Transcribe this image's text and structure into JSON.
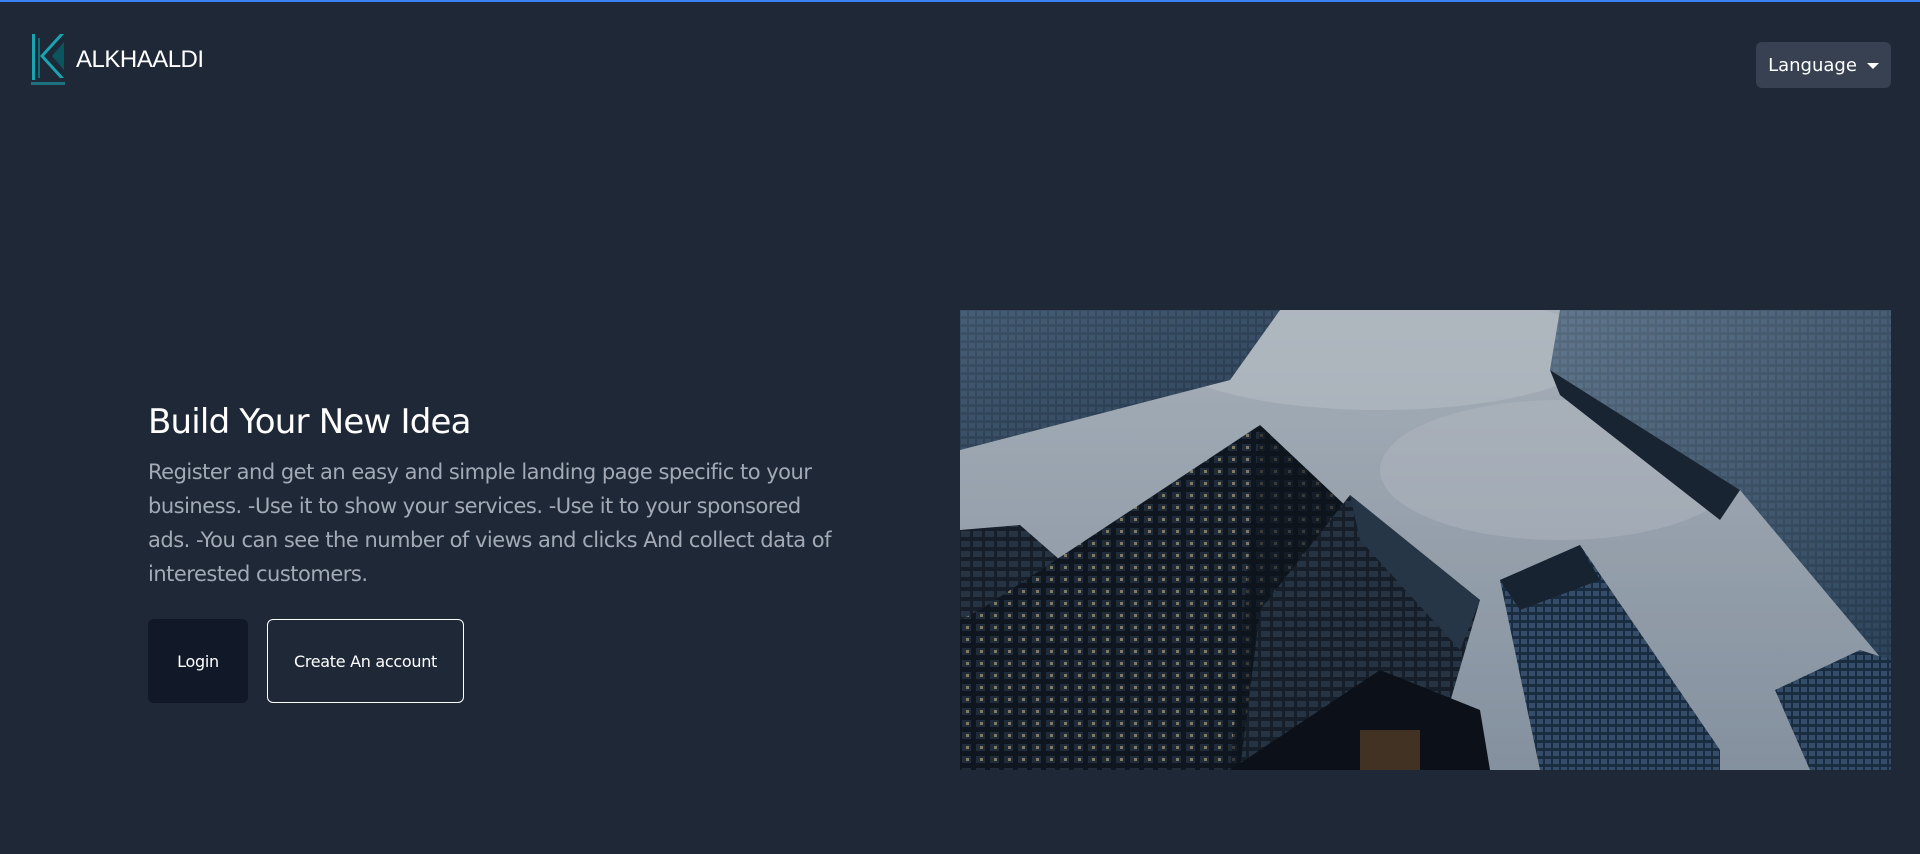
{
  "header": {
    "brand_name": "ALKHAALDI",
    "logo_icon": "alkhaaldi-k-logo",
    "language_button": "Language"
  },
  "hero": {
    "title": "Build Your New Idea",
    "description": "Register and get an easy and simple landing page specific to your business. -Use it to show your services. -Use it to your sponsored ads. -You can see the number of views and clicks And collect data of interested customers.",
    "login_button": "Login",
    "create_account_button": "Create An account",
    "image_subject": "skyscrapers-looking-up"
  },
  "colors": {
    "background": "#1f2837",
    "accent_top": "#3b82f6",
    "logo_teal": "#1aa3b0",
    "language_button_bg": "#374151",
    "login_button_bg": "#111827",
    "description_text": "#a3aab6"
  }
}
